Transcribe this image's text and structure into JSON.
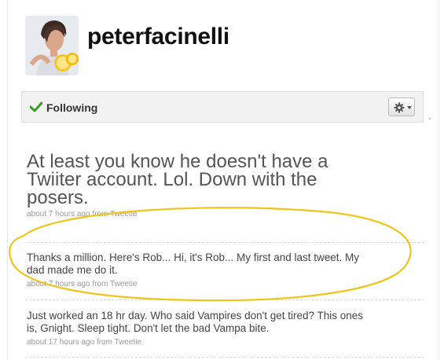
{
  "profile": {
    "username": "peterfacinelli",
    "avatar_icon": "profile-photo"
  },
  "follow_bar": {
    "status_label": "Following",
    "check_icon": "check-icon",
    "gear_icon": "gear-icon",
    "accent_color": "#3a9d23"
  },
  "tweets": [
    {
      "text": "At least you know he doesn't have a Twiiter account. Lol. Down with the posers.",
      "time": "about 7 hours ago",
      "from_word": "from",
      "source": "Tweetie"
    },
    {
      "text": "Thanks a million. Here's Rob... Hi, it's Rob... My first and last tweet. My dad made me do it.",
      "time": "about 7 hours ago",
      "from_word": "from",
      "source": "Tweetie"
    },
    {
      "text": "Just worked an 18 hr day. Who said Vampires don't get tired? This ones is, Gnight. Sleep tight. Don't let the bad Vampa bite.",
      "time": "about 17 hours ago",
      "from_word": "from",
      "source": "Tweetie"
    }
  ],
  "annotation": {
    "color": "#f0c419"
  }
}
